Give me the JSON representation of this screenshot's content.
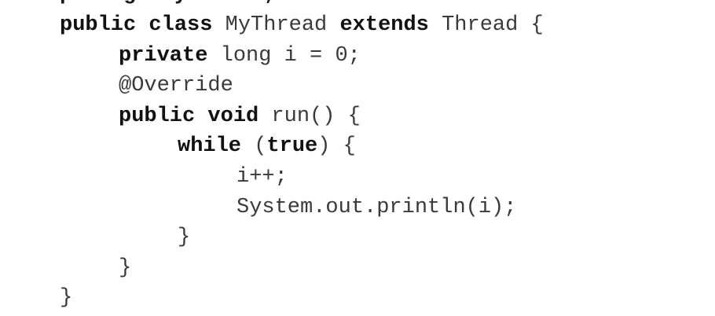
{
  "code": {
    "partial_top_line": "package mythread;",
    "lines": [
      {
        "indent": 0,
        "tokens": [
          {
            "text": "public class",
            "kw": true
          },
          {
            "text": " MyThread ",
            "kw": false
          },
          {
            "text": "extends",
            "kw": true
          },
          {
            "text": " Thread {",
            "kw": false
          }
        ]
      },
      {
        "indent": 1,
        "tokens": [
          {
            "text": "private",
            "kw": true
          },
          {
            "text": " long i = 0;",
            "kw": false
          }
        ]
      },
      {
        "indent": 1,
        "tokens": [
          {
            "text": "@Override",
            "kw": false
          }
        ]
      },
      {
        "indent": 1,
        "tokens": [
          {
            "text": "public void",
            "kw": true
          },
          {
            "text": " run() {",
            "kw": false
          }
        ]
      },
      {
        "indent": 2,
        "tokens": [
          {
            "text": "while",
            "kw": true
          },
          {
            "text": " (",
            "kw": false
          },
          {
            "text": "true",
            "kw": true
          },
          {
            "text": ") {",
            "kw": false
          }
        ]
      },
      {
        "indent": 3,
        "tokens": [
          {
            "text": "i++;",
            "kw": false
          }
        ]
      },
      {
        "indent": 3,
        "tokens": [
          {
            "text": "System.out.println(i);",
            "kw": false
          }
        ]
      },
      {
        "indent": 2,
        "tokens": [
          {
            "text": "}",
            "kw": false
          }
        ]
      },
      {
        "indent": 1,
        "tokens": [
          {
            "text": "}",
            "kw": false
          }
        ]
      },
      {
        "indent": 0,
        "tokens": [
          {
            "text": "}",
            "kw": false
          }
        ]
      }
    ]
  }
}
